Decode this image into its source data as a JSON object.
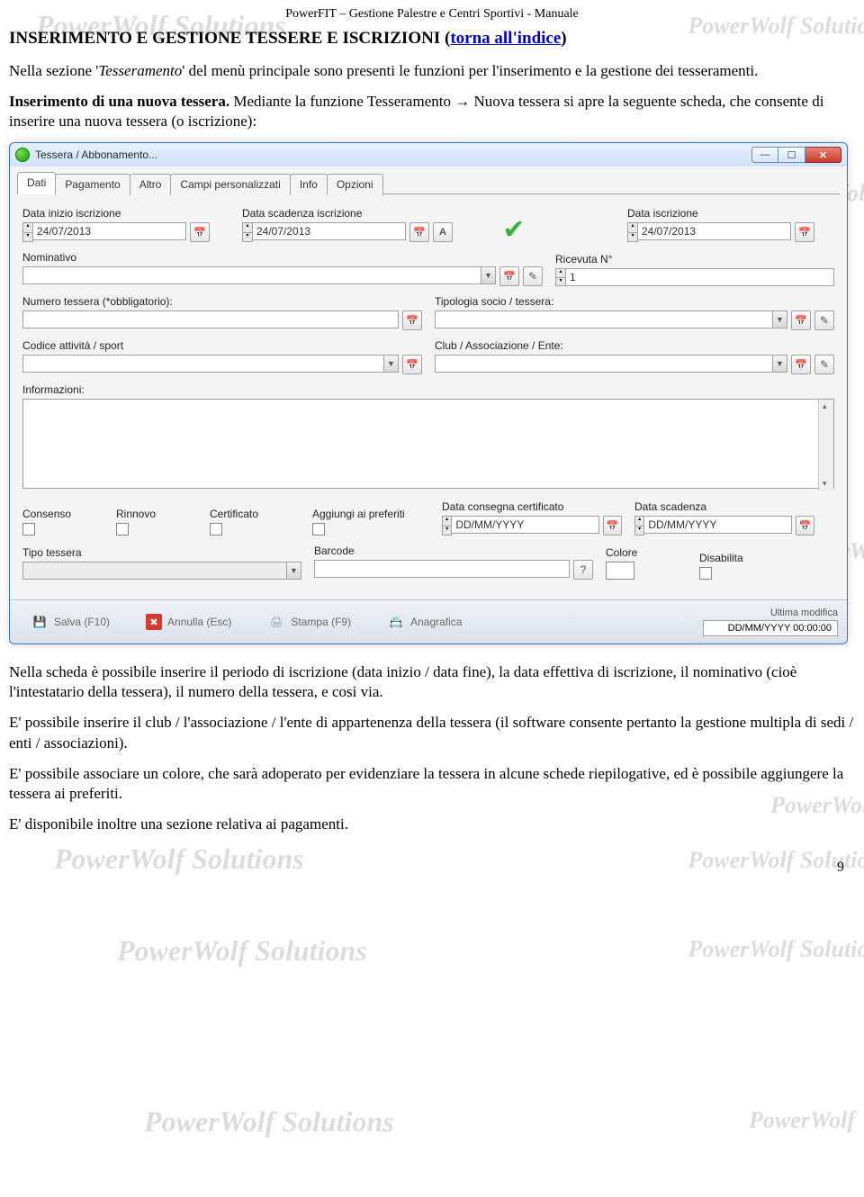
{
  "doc_header": "PowerFIT – Gestione Palestre e Centri Sportivi - Manuale",
  "section_title_plain": "INSERIMENTO E GESTIONE TESSERE E ISCRIZIONI (",
  "section_title_link": "torna all'indice",
  "section_title_tail": ")",
  "intro_1_pre": "Nella sezione '",
  "intro_1_em": "Tesseramento",
  "intro_1_post": "' del menù principale sono presenti le funzioni per l'inserimento e la gestione dei tesseramenti.",
  "intro_2_bold": "Inserimento di una nuova tessera.",
  "intro_2_rest_a": " Mediante la funzione Tesseramento ",
  "intro_2_arrow": "→",
  "intro_2_rest_b": " Nuova tessera si apre la seguente scheda, che consente di inserire una nuova tessera (o iscrizione):",
  "watermark_long": "PowerWolf Solutions",
  "watermark_short": "PowerWolf",
  "window": {
    "title": "Tessera / Abbonamento...",
    "tabs": [
      "Dati",
      "Pagamento",
      "Altro",
      "Campi personalizzati",
      "Info",
      "Opzioni"
    ],
    "labels": {
      "data_inizio": "Data inizio iscrizione",
      "data_scadenza": "Data scadenza iscrizione",
      "data_iscr": "Data iscrizione",
      "nominativo": "Nominativo",
      "ricevuta": "Ricevuta N°",
      "numero_tessera": "Numero tessera (*obbligatorio):",
      "tipologia": "Tipologia socio / tessera:",
      "codice_attivita": "Codice attività / sport",
      "club": "Club / Associazione / Ente:",
      "informazioni": "Informazioni:",
      "consenso": "Consenso",
      "rinnovo": "Rinnovo",
      "certificato": "Certificato",
      "preferiti": "Aggiungi ai preferiti",
      "data_consegna_cert": "Data consegna certificato",
      "data_scadenza2": "Data scadenza",
      "tipo_tessera": "Tipo tessera",
      "barcode": "Barcode",
      "colore": "Colore",
      "disabilita": "Disabilita"
    },
    "values": {
      "data_inizio": "24/07/2013",
      "data_scadenza": "24/07/2013",
      "data_iscr": "24/07/2013",
      "ricevuta": "1",
      "date_placeholder": "DD/MM/YYYY"
    },
    "footer": {
      "salva": "Salva  (F10)",
      "annulla": "Annulla  (Esc)",
      "stampa": "Stampa  (F9)",
      "anagrafica": "Anagrafica",
      "ultima_modifica_label": "Ultima modifica",
      "ultima_modifica_value": "DD/MM/YYYY 00:00:00"
    }
  },
  "para_after_1": "Nella scheda è possibile inserire il periodo di iscrizione (data inizio / data fine), la data effettiva di iscrizione, il nominativo (cioè l'intestatario della tessera), il numero della tessera, e cosi via.",
  "para_after_2": "E' possibile inserire il club / l'associazione / l'ente di appartenenza della tessera (il software consente pertanto la gestione multipla di sedi / enti / associazioni).",
  "para_after_3": "E' possibile associare un colore, che sarà adoperato per evidenziare la tessera in alcune schede riepilogative, ed è possibile aggiungere la tessera ai preferiti.",
  "para_after_4": "E' disponibile inoltre una sezione relativa ai pagamenti.",
  "page_number": "9"
}
